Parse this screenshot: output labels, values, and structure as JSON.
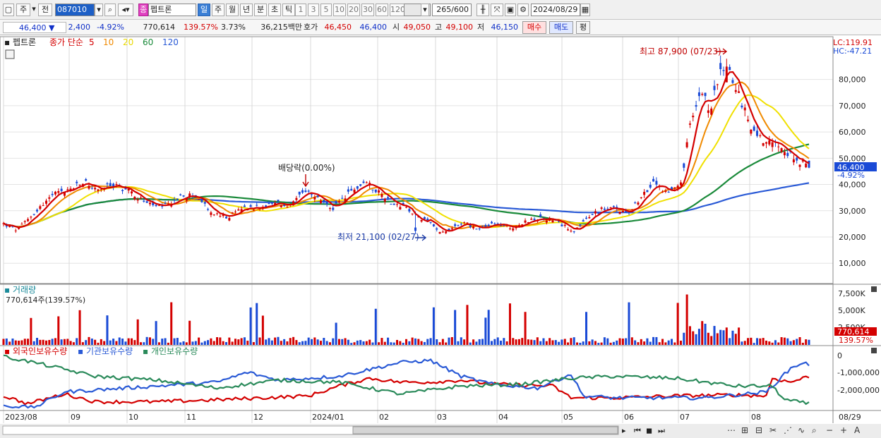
{
  "toolbar": {
    "period_toggle": "주",
    "prev_label": "전",
    "code": "087010",
    "stock_name": "펩트론",
    "stock_badge": "종",
    "period_buttons": [
      {
        "label": "일",
        "selected": true
      },
      {
        "label": "주",
        "selected": false
      },
      {
        "label": "월",
        "selected": false
      },
      {
        "label": "년",
        "selected": false
      },
      {
        "label": "분",
        "selected": false
      },
      {
        "label": "초",
        "selected": false
      },
      {
        "label": "틱",
        "selected": false
      }
    ],
    "interval_buttons": [
      "1",
      "3",
      "5",
      "10",
      "20",
      "30",
      "60",
      "120"
    ],
    "count": "265",
    "count_total": "/600",
    "date": "2024/08/29"
  },
  "quote": {
    "price": "46,400",
    "change": "2,400",
    "change_pct": "-4.92%",
    "volume": "770,614",
    "volume_ratio": "139.57%",
    "turnover": "3.73%",
    "amount": "36,215백만",
    "ask_label": "호가",
    "ask1": "46,450",
    "ask2": "46,400",
    "open_label": "시",
    "open": "49,050",
    "high_label": "고",
    "high": "49,100",
    "low_label": "저",
    "low": "46,150",
    "buy_label": "매수",
    "sell_label": "매도",
    "eval_label": "평"
  },
  "legend": {
    "name": "펩트론",
    "ma_title": "종가 단순",
    "ma_periods": [
      {
        "label": "5",
        "color": "#d40000"
      },
      {
        "label": "10",
        "color": "#f08a00"
      },
      {
        "label": "20",
        "color": "#e8d800"
      },
      {
        "label": "60",
        "color": "#1a8a3a"
      },
      {
        "label": "120",
        "color": "#2a5ad6"
      }
    ]
  },
  "annotations": {
    "lc": "LC:119.91",
    "hc": "HC:-47.21",
    "high_text": "최고 87,900 (07/23)",
    "low_text": "최저 21,100 (02/27)",
    "dividend_text": "배당락(0.00%)",
    "last_price": "46,400",
    "last_change": "-4.92%"
  },
  "volume_panel": {
    "title": "거래량",
    "info": "770,614주(139.57%)",
    "last_value": "770,614",
    "last_pct": "139.57%",
    "ticks": [
      "7,500K",
      "5,000K",
      "2,500K"
    ]
  },
  "holdings_panel": {
    "series": [
      {
        "name": "외국인보유수량",
        "color": "#d40000"
      },
      {
        "name": "기관보유수량",
        "color": "#2a5ad6"
      },
      {
        "name": "개인보유수량",
        "color": "#2a8a5a"
      }
    ],
    "ticks": [
      "0",
      "-1,000,000",
      "-2,000,000"
    ]
  },
  "xaxis": {
    "labels": [
      "2023/08",
      "09",
      "10",
      "11",
      "12",
      "2024/01",
      "02",
      "03",
      "04",
      "05",
      "06",
      "07",
      "08"
    ],
    "right_label": "08/29"
  },
  "colors": {
    "up": "#d40000",
    "down": "#1a4ad6",
    "ma5": "#d40000",
    "ma10": "#f08a00",
    "ma20": "#f0e000",
    "ma60": "#1a8a3a",
    "ma120": "#2a5ad6"
  },
  "chart_data": {
    "type": "candlestick",
    "title": "펩트론",
    "y_ticks": [
      10000,
      20000,
      30000,
      40000,
      50000,
      60000,
      70000,
      80000
    ],
    "ylim": [
      2000,
      92000
    ],
    "close_approx": [
      {
        "date": "2023/08",
        "close": 24000
      },
      {
        "date": "2023/09",
        "close": 38000
      },
      {
        "date": "2023/10",
        "close": 32000
      },
      {
        "date": "2023/11",
        "close": 30000
      },
      {
        "date": "2023/12",
        "close": 34000
      },
      {
        "date": "2024/01",
        "close": 38000
      },
      {
        "date": "2024/02",
        "close": 23000
      },
      {
        "date": "2024/03",
        "close": 25000
      },
      {
        "date": "2024/04",
        "close": 26000
      },
      {
        "date": "2024/05",
        "close": 30000
      },
      {
        "date": "2024/06",
        "close": 40000
      },
      {
        "date": "2024/07",
        "close": 80000
      },
      {
        "date": "2024/08",
        "close": 46400
      }
    ],
    "high": {
      "value": 87900,
      "date": "07/23"
    },
    "low": {
      "value": 21100,
      "date": "02/27"
    },
    "last": {
      "value": 46400,
      "change_pct": -4.92
    }
  }
}
